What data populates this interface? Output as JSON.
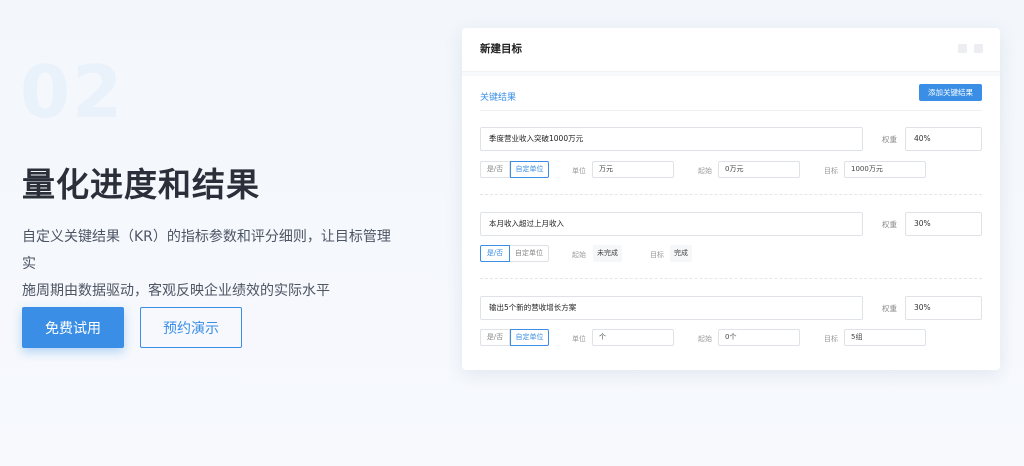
{
  "hero": {
    "number": "02",
    "title": "量化进度和结果",
    "desc_line1": "自定义关键结果（KR）的指标参数和评分细则，让目标管理实",
    "desc_line2": "施周期由数据驱动，客观反映企业绩效的实际水平",
    "primary_button": "免费试用",
    "secondary_button": "预约演示"
  },
  "colors": {
    "accent": "#3a8ee6",
    "title_text": "#2a2f3a",
    "big_number": "#e9f1fb"
  },
  "card": {
    "title": "新建目标",
    "section_label": "关键结果",
    "add_button": "添加关键结果",
    "weight_label": "权重",
    "kr_items": [
      {
        "name": "季度营业收入突破1000万元",
        "weight": "40%",
        "toggle": [
          "是/否",
          "自定单位"
        ],
        "unit_label": "单位",
        "unit_value": "万元",
        "start_label": "起始",
        "start_value": "0万元",
        "target_label": "目标",
        "target_value": "1000万元"
      },
      {
        "name": "本月收入超过上月收入",
        "weight": "30%",
        "toggle": [
          "是/否",
          "自定单位"
        ],
        "start_label": "起始",
        "start_value": "未完成",
        "target_label": "目标",
        "target_value": "完成"
      },
      {
        "name": "输出5个新的营收增长方案",
        "weight": "30%",
        "toggle": [
          "是/否",
          "自定单位"
        ],
        "unit_label": "单位",
        "unit_value": "个",
        "start_label": "起始",
        "start_value": "0个",
        "target_label": "目标",
        "target_value": "5组"
      }
    ]
  }
}
